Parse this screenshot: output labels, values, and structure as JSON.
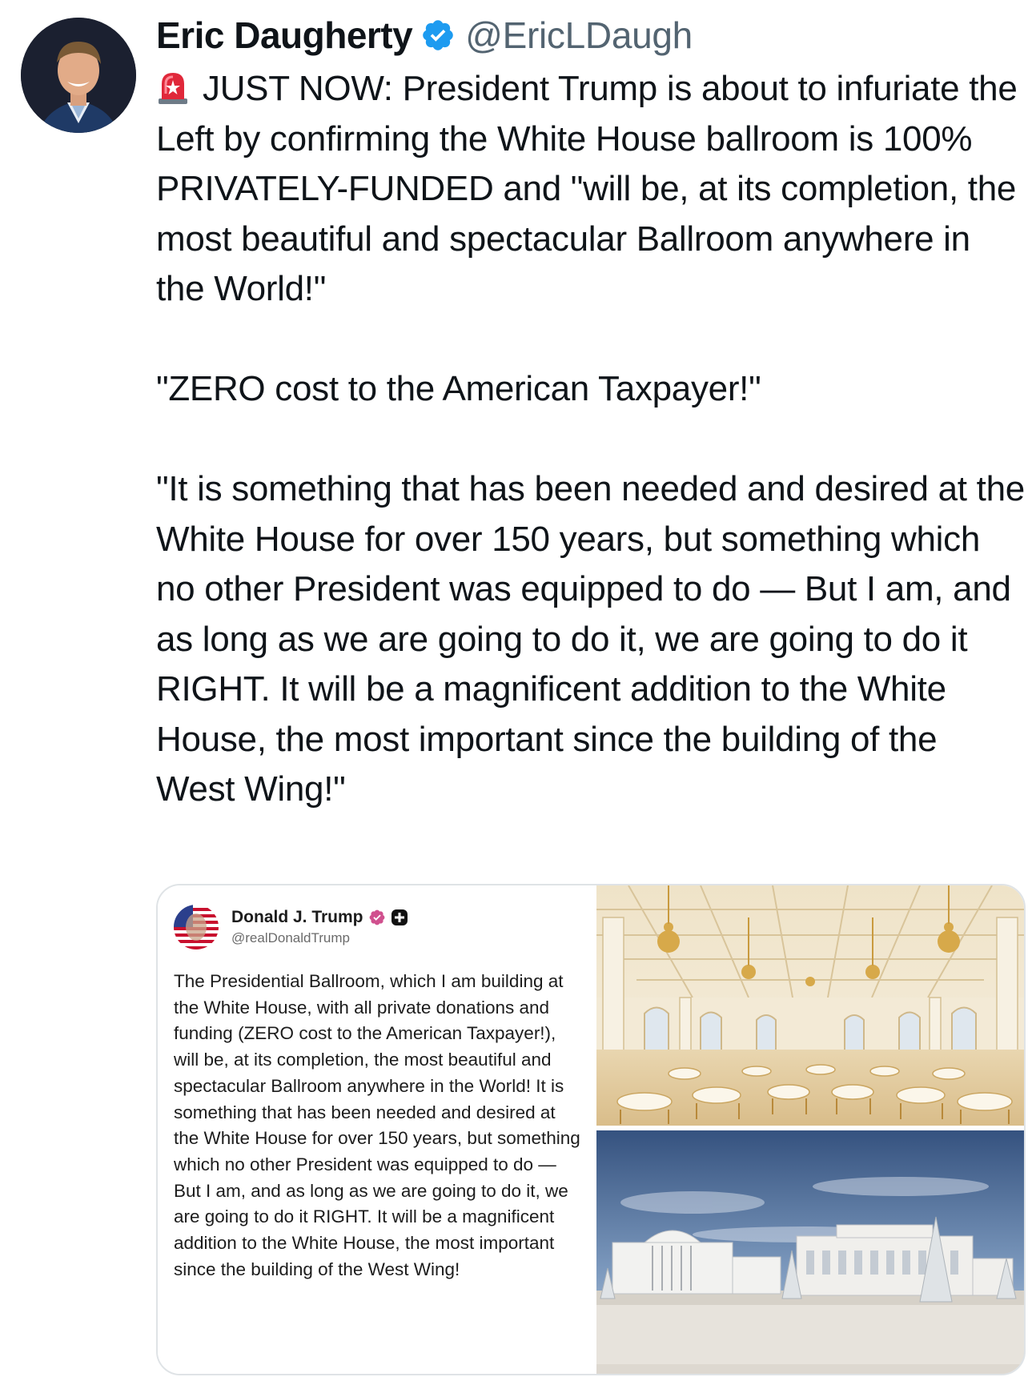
{
  "author": {
    "display_name": "Eric Daugherty",
    "handle": "@EricLDaugh"
  },
  "tweet": {
    "paragraphs": [
      "JUST NOW: President Trump is about to infuriate the Left by confirming the White House ballroom is 100% PRIVATELY-FUNDED and \"will be, at its completion, the most beautiful and spectacular Ballroom anywhere in the World!\"",
      "\"ZERO cost to the American Taxpayer!\"",
      "\"It is something that has been needed and desired at the White House for over 150 years, but something which no other President was equipped to do — But I am, and as long as we are going to do it, we are going to do it RIGHT. It will be a magnificent addition to the White House, the most important since the building of the West Wing!\""
    ]
  },
  "embedded_post": {
    "display_name": "Donald J. Trump",
    "handle": "@realDonaldTrump",
    "body": "The Presidential Ballroom, which I am building at the White House, with all private donations and funding (ZERO cost to the American Taxpayer!), will be, at its completion, the most beautiful and spectacular Ballroom anywhere in the World! It is something that has been needed and desired at the White House for over 150 years, but something which no other President was equipped to do — But I am, and as long as we are going to do it, we are going to do it RIGHT. It will be a magnificent addition to the White House, the most important since the building of the West Wing!"
  },
  "icons": {
    "siren": "siren-emoji-icon",
    "verified": "verified-badge-icon"
  },
  "colors": {
    "verified_blue": "#1d9bf0",
    "handle_gray": "#536471",
    "truth_badge": "#d0508e"
  }
}
